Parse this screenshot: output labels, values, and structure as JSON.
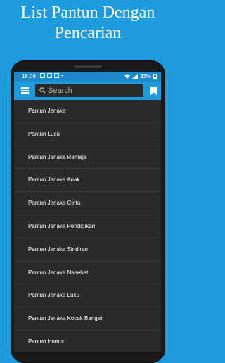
{
  "promo": {
    "title_line1": "List Pantun Dengan",
    "title_line2": "Pencarian"
  },
  "statusbar": {
    "time": "16:08",
    "battery": "33%"
  },
  "appbar": {
    "search_placeholder": "Search",
    "menu_icon": "hamburger-menu-icon",
    "search_icon": "magnifier-icon",
    "bookmark_icon": "bookmark-icon"
  },
  "list": {
    "items": [
      "Pantun Jenaka",
      "Pantun Lucu",
      "Pantun Jenaka Remaja",
      "Pantun Jenaka Anak",
      "Pantun Jenaka Cinta",
      "Pantun Jenaka Pendidikan",
      "Pantun Jenaka Sindiran",
      "Pantun Jenaka Nasehat",
      "Pantun Jenaka Lucu",
      "Pantun Jenaka Kocak Banget",
      "Pantun Humor"
    ]
  },
  "colors": {
    "background": "#1e9bdc",
    "appbar": "#1e9bdc",
    "list_background": "#2b2b2b"
  }
}
